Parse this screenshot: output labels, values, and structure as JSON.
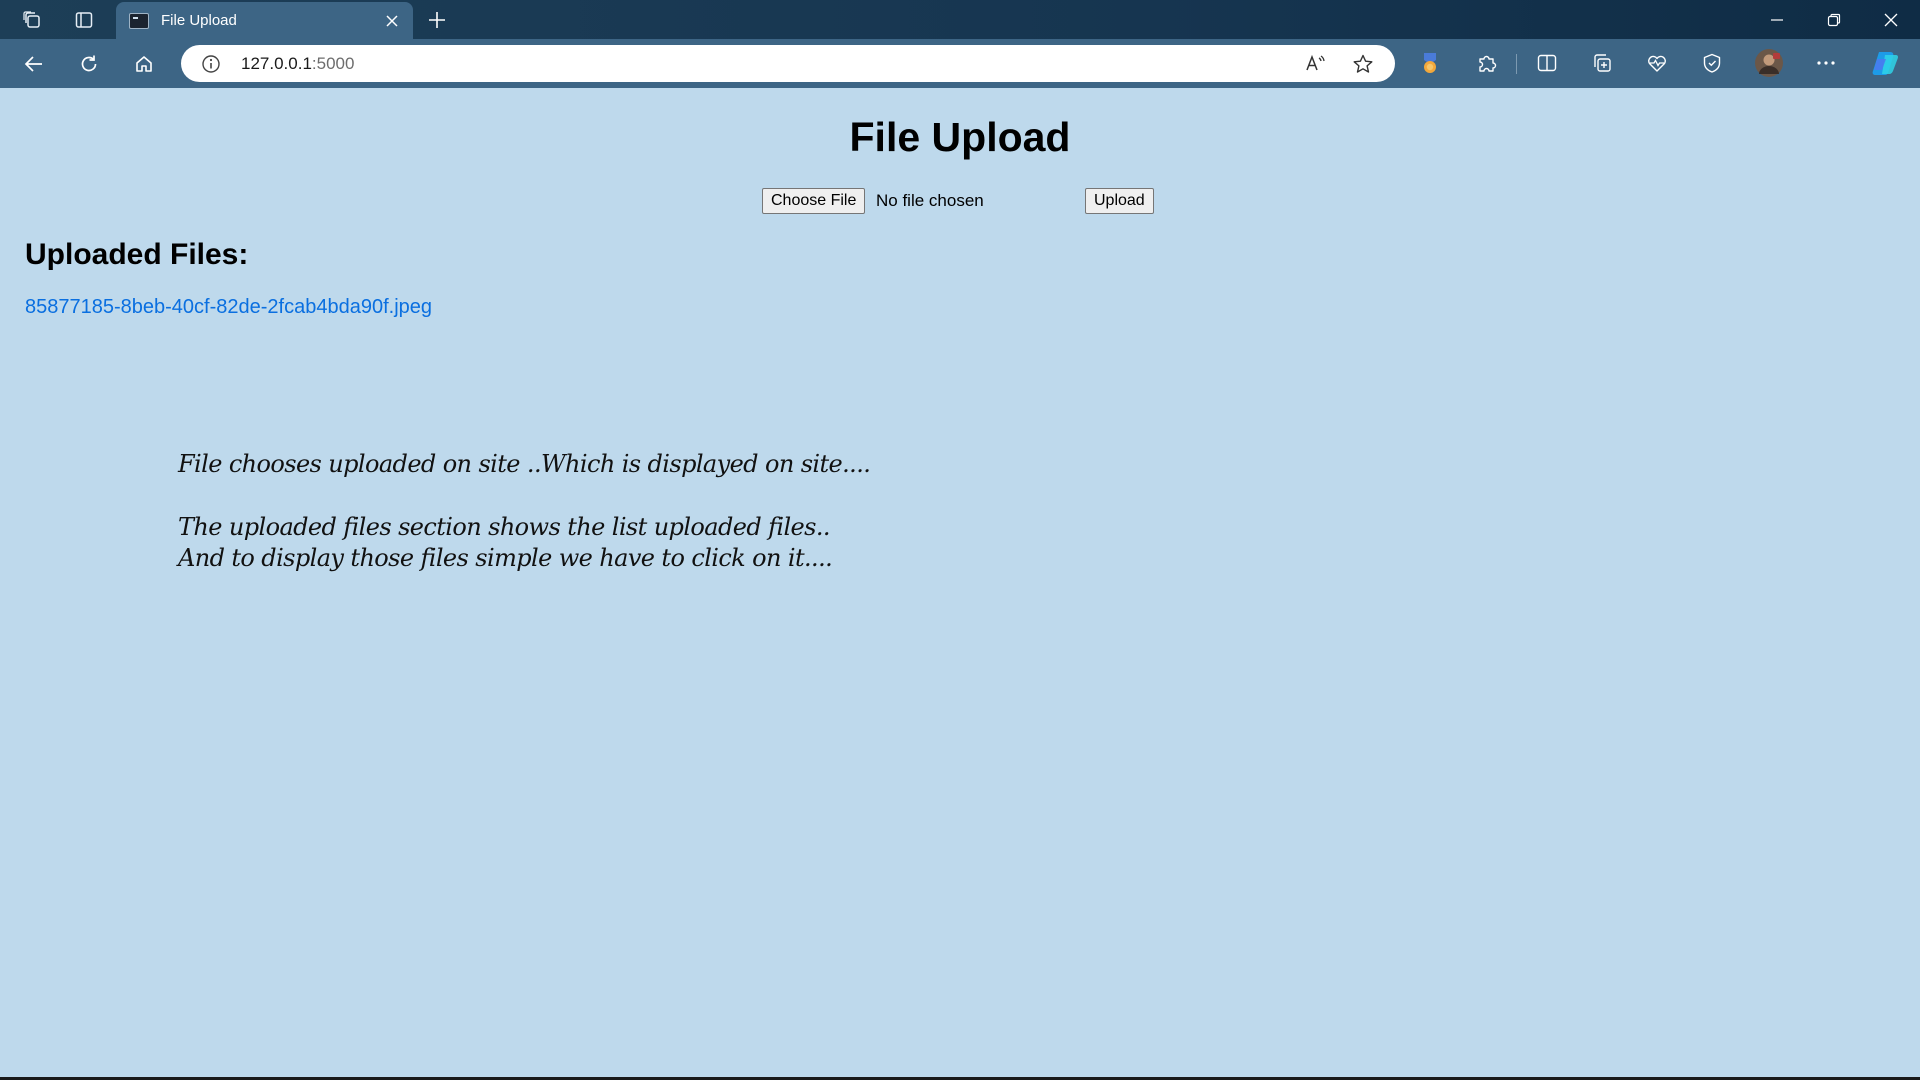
{
  "browser": {
    "tab": {
      "title": "File Upload"
    },
    "address": {
      "host": "127.0.0.1",
      "port": ":5000"
    },
    "icons": {
      "workspaces": "workspaces-icon",
      "tab_actions": "tab-actions-icon",
      "new_tab": "plus-icon",
      "back": "back-arrow-icon",
      "refresh": "refresh-icon",
      "home": "home-icon",
      "site_info": "info-icon",
      "read_aloud": "read-aloud-icon",
      "favorite": "star-icon",
      "rewards": "rewards-icon",
      "extensions": "puzzle-icon",
      "split_screen": "split-screen-icon",
      "collections": "collections-icon",
      "performance": "heart-pulse-icon",
      "browser_essentials": "shield-icon",
      "profile": "avatar",
      "more": "more-icon",
      "copilot": "copilot-icon"
    },
    "colors": {
      "titlebar": "#163550",
      "toolbar": "#3d6585",
      "page_background": "#bed9ec",
      "link": "#0a6fe0"
    }
  },
  "page": {
    "title": "File Upload",
    "form": {
      "choose_label": "Choose File",
      "file_status": "No file chosen",
      "upload_label": "Upload"
    },
    "uploaded": {
      "heading": "Uploaded Files:",
      "files": [
        "85877185-8beb-40cf-82de-2fcab4bda90f.jpeg"
      ]
    },
    "notes": [
      "File chooses uploaded on site ..Which is displayed on site....",
      "The uploaded files section shows the list uploaded  files..",
      "And to display those files simple we have to click on it...."
    ]
  }
}
